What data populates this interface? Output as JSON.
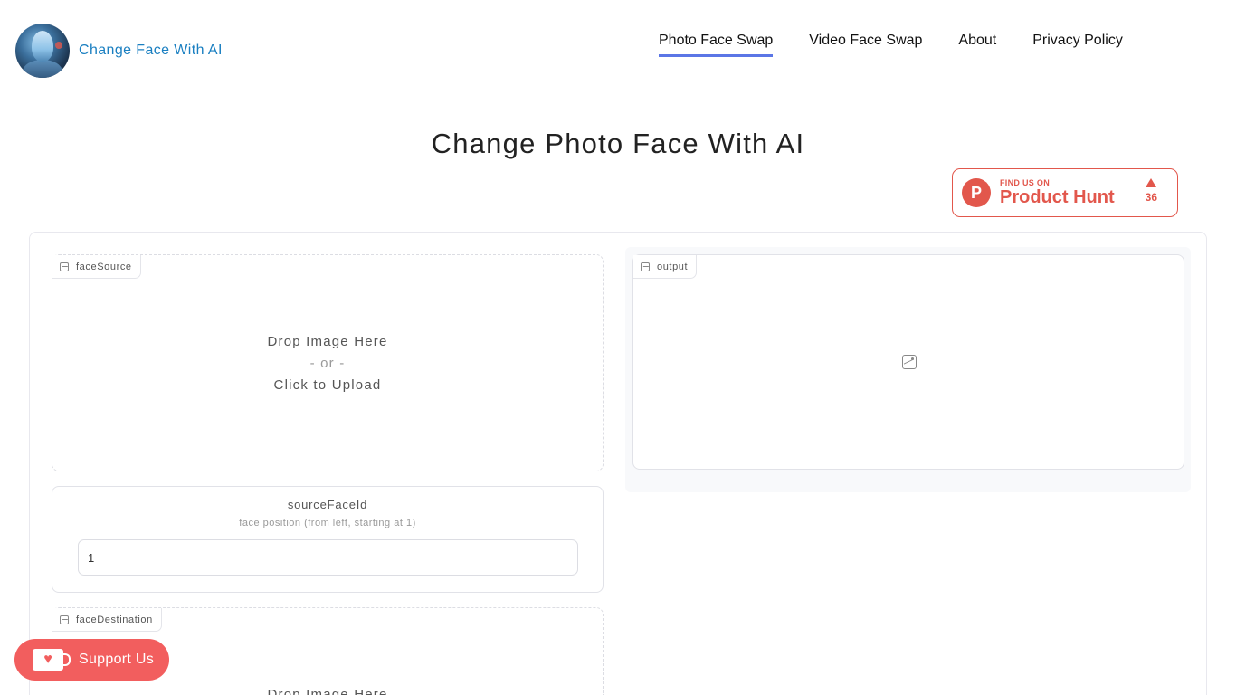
{
  "header": {
    "site_name": "Change Face With AI",
    "nav": [
      {
        "label": "Photo Face Swap",
        "active": true
      },
      {
        "label": "Video Face Swap",
        "active": false
      },
      {
        "label": "About",
        "active": false
      },
      {
        "label": "Privacy Policy",
        "active": false
      }
    ]
  },
  "page_title": "Change Photo Face With AI",
  "product_hunt": {
    "find": "FIND US ON",
    "name": "Product Hunt",
    "votes": "36",
    "logo_letter": "P"
  },
  "face_source": {
    "label": "faceSource",
    "drop": "Drop Image Here",
    "or": "- or -",
    "click": "Click to Upload"
  },
  "output": {
    "label": "output"
  },
  "source_face_id": {
    "title": "sourceFaceId",
    "description": "face position (from left, starting at 1)",
    "value": "1"
  },
  "face_destination": {
    "label": "faceDestination",
    "drop": "Drop Image Here"
  },
  "support": {
    "label": "Support Us"
  },
  "colors": {
    "accent": "#5b76e6",
    "brand": "#1a7fc1",
    "product_hunt": "#e2574c",
    "support": "#f25e5e"
  }
}
